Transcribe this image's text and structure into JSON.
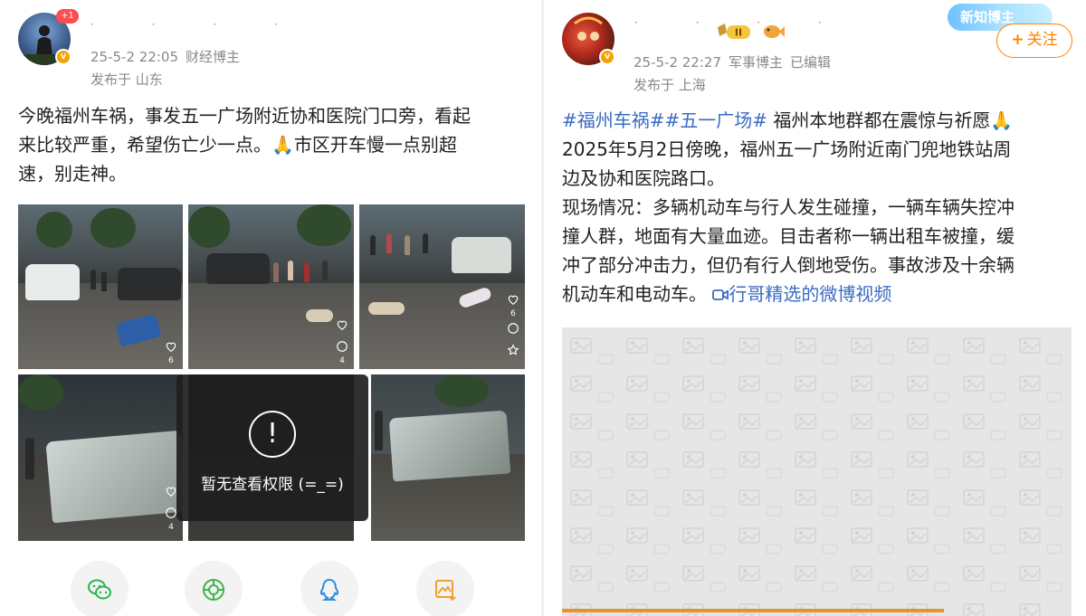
{
  "left_post": {
    "notification_count": "+1",
    "date": "25-5-2 22:05",
    "author_tag": "财经博主",
    "location": "发布于 山东",
    "text_lines": [
      "今晚福州车祸，事发五一广场附近协和医院门口旁，看起",
      "来比较严重，希望伤亡少一点。🙏市区开车慢一点别超",
      "速，别走神。"
    ],
    "thumbs": [
      {
        "count": "6"
      },
      {
        "count": "4"
      },
      {
        "count": "6"
      },
      {
        "count": "4"
      }
    ],
    "blocked_icon": "!",
    "blocked_text": "暂无查看权限 (=_=)",
    "share_icons": [
      "wechat-icon",
      "moments-icon",
      "qq-icon",
      "save-image-icon"
    ]
  },
  "right_post": {
    "date": "25-5-2 22:27",
    "author_tag": "军事博主",
    "edited": "已编辑",
    "location": "发布于 上海",
    "badge_level": "II",
    "promo_label": "新知博主",
    "follow_label": "关注",
    "follow_plus": "+",
    "hashtag1": "#福州车祸#",
    "hashtag2": "#五一广场#",
    "line1_rest": " 福州本地群都在震惊与祈愿🙏",
    "line2": "2025年5月2日傍晚，福州五一广场附近南门兜地铁站周",
    "line3": "边及协和医院路口。",
    "line4": "现场情况：多辆机动车与行人发生碰撞，一辆车辆失控冲",
    "line5": "撞人群，地面有大量血迹。目击者称一辆出租车被撞，缓",
    "line6": "冲了部分冲击力，但仍有行人倒地受伤。事故涉及十余辆",
    "line7_start": "机动车和电动车。",
    "video_link": "行哥精选的微博视频",
    "video_progress": 0.75
  },
  "colors": {
    "link": "#3a6bc4",
    "orange": "#ff8200"
  }
}
